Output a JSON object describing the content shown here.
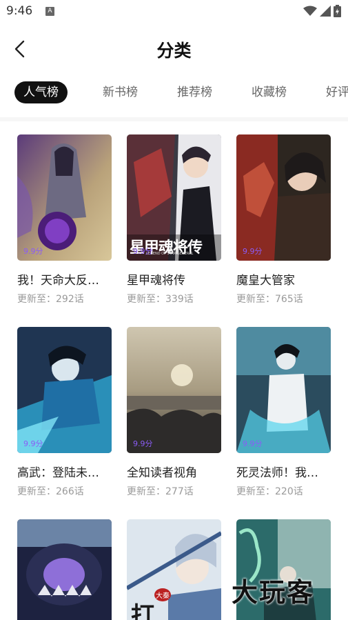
{
  "status_bar": {
    "time": "9:46",
    "notification_icon": "A"
  },
  "header": {
    "title": "分类",
    "back_icon": "chevron-left-icon"
  },
  "tabs": [
    {
      "label": "人气榜",
      "active": true
    },
    {
      "label": "新书榜",
      "active": false
    },
    {
      "label": "推荐榜",
      "active": false
    },
    {
      "label": "收藏榜",
      "active": false
    },
    {
      "label": "好评",
      "active": false
    }
  ],
  "comics": [
    {
      "title": "我！天命大反…",
      "score": "9.9分",
      "update": "更新至：292话"
    },
    {
      "title": "星甲魂将传",
      "score": "9.9分",
      "update": "更新至：339话",
      "cover_text": "星甲魂将传",
      "cover_subtext": "LEGEND OF STAR GENERAL"
    },
    {
      "title": "魔皇大管家",
      "score": "9.9分",
      "update": "更新至：765话"
    },
    {
      "title": "高武：登陆未…",
      "score": "9.9分",
      "update": "更新至：266话"
    },
    {
      "title": "全知读者视角",
      "score": "9.9分",
      "update": "更新至：277话"
    },
    {
      "title": "死灵法师！我…",
      "score": "9.9分",
      "update": "更新至：220话"
    },
    {
      "title": "",
      "score": "",
      "update": ""
    },
    {
      "title": "",
      "score": "",
      "update": "",
      "cover_text": "打",
      "cover_badge": "大秦"
    },
    {
      "title": "",
      "score": "",
      "update": ""
    }
  ],
  "watermark": "大玩客",
  "colors": {
    "accent": "#111111",
    "score": "#8b5cf6",
    "muted": "#999999"
  }
}
